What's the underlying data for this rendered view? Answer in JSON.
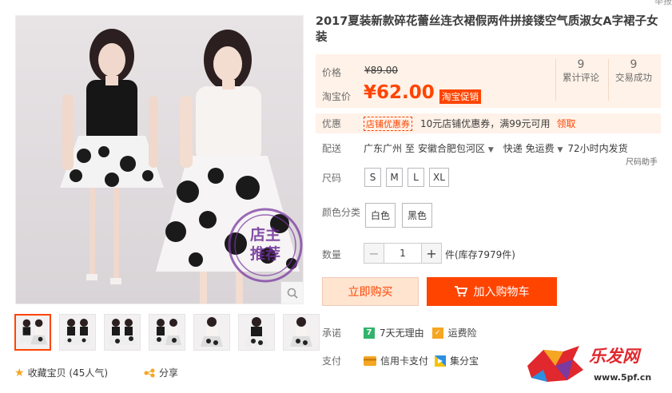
{
  "report": "举报",
  "product": {
    "title": "2017夏装新款碎花蕾丝连衣裙假两件拼接镂空气质淑女A字裙子女装",
    "stamp_line1": "店主",
    "stamp_line2": "推荐"
  },
  "price": {
    "label": "价格",
    "original": "¥89.00",
    "taobao_label": "淘宝价",
    "current": "¥62.00",
    "promo_tag": "淘宝促销"
  },
  "stats": [
    {
      "num": "9",
      "label": "累计评论"
    },
    {
      "num": "9",
      "label": "交易成功"
    }
  ],
  "coupon": {
    "label": "优惠",
    "tag": "店铺优惠券",
    "text": "10元店铺优惠券，满99元可用",
    "link": "领取"
  },
  "shipping": {
    "label": "配送",
    "from": "广东广州",
    "to_word": "至",
    "to": "安徽合肥包河区",
    "method": "快递 免运费",
    "time": "72小时内发货",
    "size_helper": "尺码助手"
  },
  "sizes": {
    "label": "尺码",
    "options": [
      "S",
      "M",
      "L",
      "XL"
    ]
  },
  "colors": {
    "label": "颜色分类",
    "options": [
      "白色",
      "黑色"
    ]
  },
  "quantity": {
    "label": "数量",
    "value": "1",
    "minus": "−",
    "plus": "+",
    "stock": "件(库存7979件)"
  },
  "actions": {
    "buy_now": "立即购买",
    "add_cart": "加入购物车"
  },
  "promise": {
    "label": "承诺",
    "badge_num": "7",
    "return_text": "7天无理由",
    "insurance": "运费险"
  },
  "payment": {
    "label": "支付",
    "credit": "信用卡支付",
    "jifen": "集分宝"
  },
  "bottom": {
    "favorite": "收藏宝贝 (45人气)",
    "share": "分享"
  },
  "watermark": {
    "text": "乐发网",
    "url": "www.5pf.cn"
  },
  "colors_theme": {
    "accent": "#ff4400",
    "price_bg": "#fff2e8"
  }
}
